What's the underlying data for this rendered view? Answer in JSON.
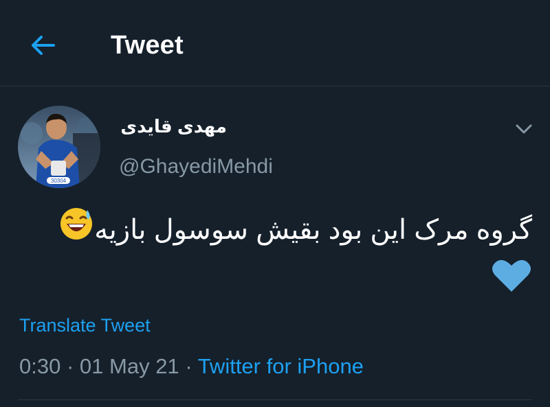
{
  "header": {
    "title": "Tweet",
    "back_icon": "arrow-left-icon"
  },
  "author": {
    "display_name": "مهدی قایدی",
    "handle": "@GhayediMehdi",
    "avatar_icon": "avatar-photo",
    "more_icon": "chevron-down-icon"
  },
  "tweet": {
    "text": "گروه مرک این بود بقیش سوسول بازیه",
    "emojis": [
      "grinning-sweat-emoji",
      "blue-heart-emoji"
    ]
  },
  "translate_label": "Translate Tweet",
  "meta": {
    "time": "0:30",
    "separator": "·",
    "date": "01 May 21",
    "source": "Twitter for iPhone"
  },
  "colors": {
    "background": "#15202b",
    "accent": "#1da1f2",
    "secondary_text": "#8899a6",
    "heart": "#5dade2"
  }
}
